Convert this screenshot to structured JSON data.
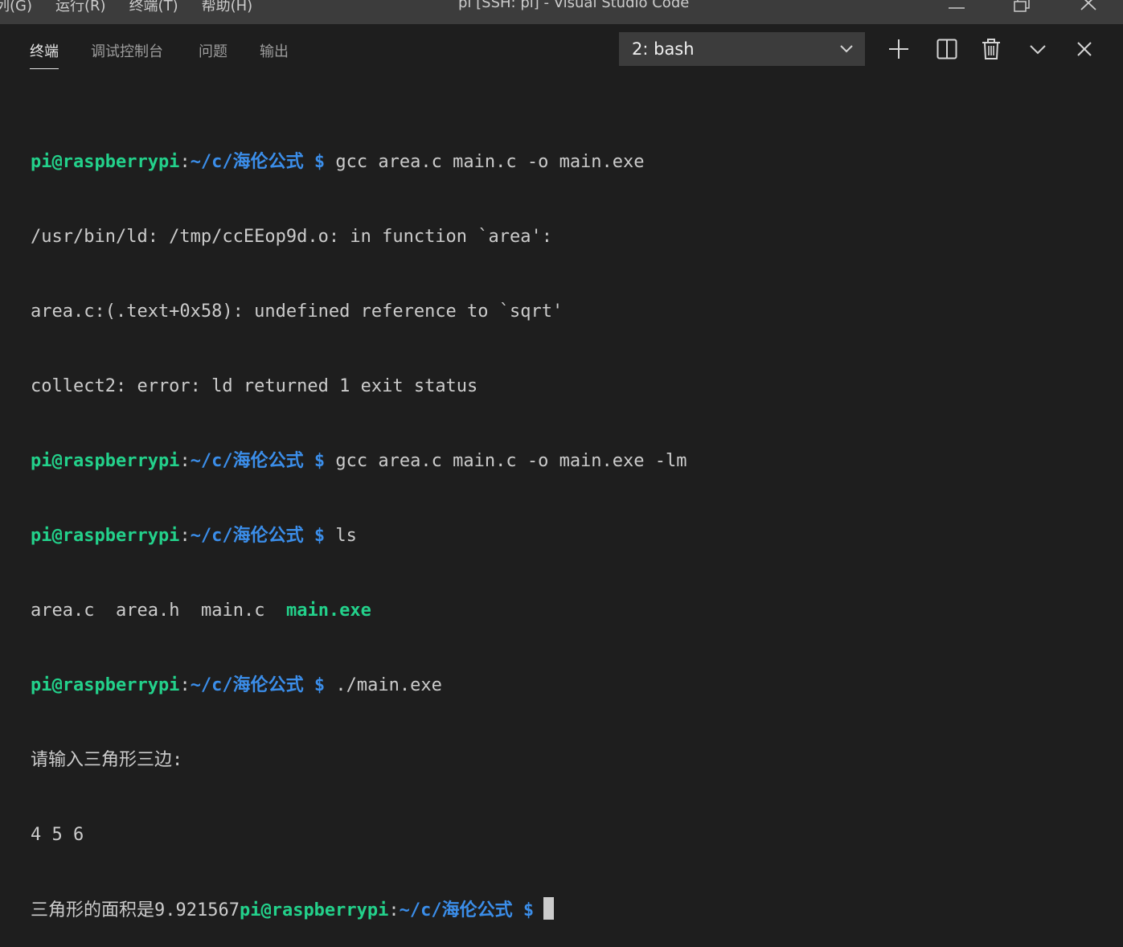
{
  "menu": {
    "items": [
      "列(G)",
      "运行(R)",
      "终端(T)",
      "帮助(H)"
    ]
  },
  "window": {
    "title": "pi [SSH: pi] - Visual Studio Code"
  },
  "panel": {
    "tabs": [
      "终端",
      "调试控制台",
      "问题",
      "输出"
    ],
    "active_tab": "终端",
    "terminal_select": "2: bash",
    "icons": [
      "plus-icon",
      "split-icon",
      "trash-icon",
      "chevron-down-icon",
      "close-icon"
    ]
  },
  "terminal": {
    "user_host": "pi@raspberrypi",
    "cwd": "~/c/海伦公式",
    "prompt_symbol": "$",
    "cmd1": "gcc area.c main.c -o main.exe",
    "err1": "/usr/bin/ld: /tmp/ccEEop9d.o: in function `area':",
    "err2": "area.c:(.text+0x58): undefined reference to `sqrt'",
    "err3": "collect2: error: ld returned 1 exit status",
    "cmd2": "gcc area.c main.c -o main.exe -lm",
    "cmd3": "ls",
    "ls_files": [
      "area.c",
      "area.h",
      "main.c"
    ],
    "ls_exec": "main.exe",
    "cmd4": "./main.exe",
    "out1": "请输入三角形三边:",
    "out2": "4 5 6",
    "out3": "三角形的面积是9.921567"
  },
  "colors": {
    "background": "#1e1e1e",
    "titlebar": "#3c3c3c",
    "prompt_user": "#23d18b",
    "prompt_path": "#3b8eea",
    "text": "#cccccc"
  }
}
